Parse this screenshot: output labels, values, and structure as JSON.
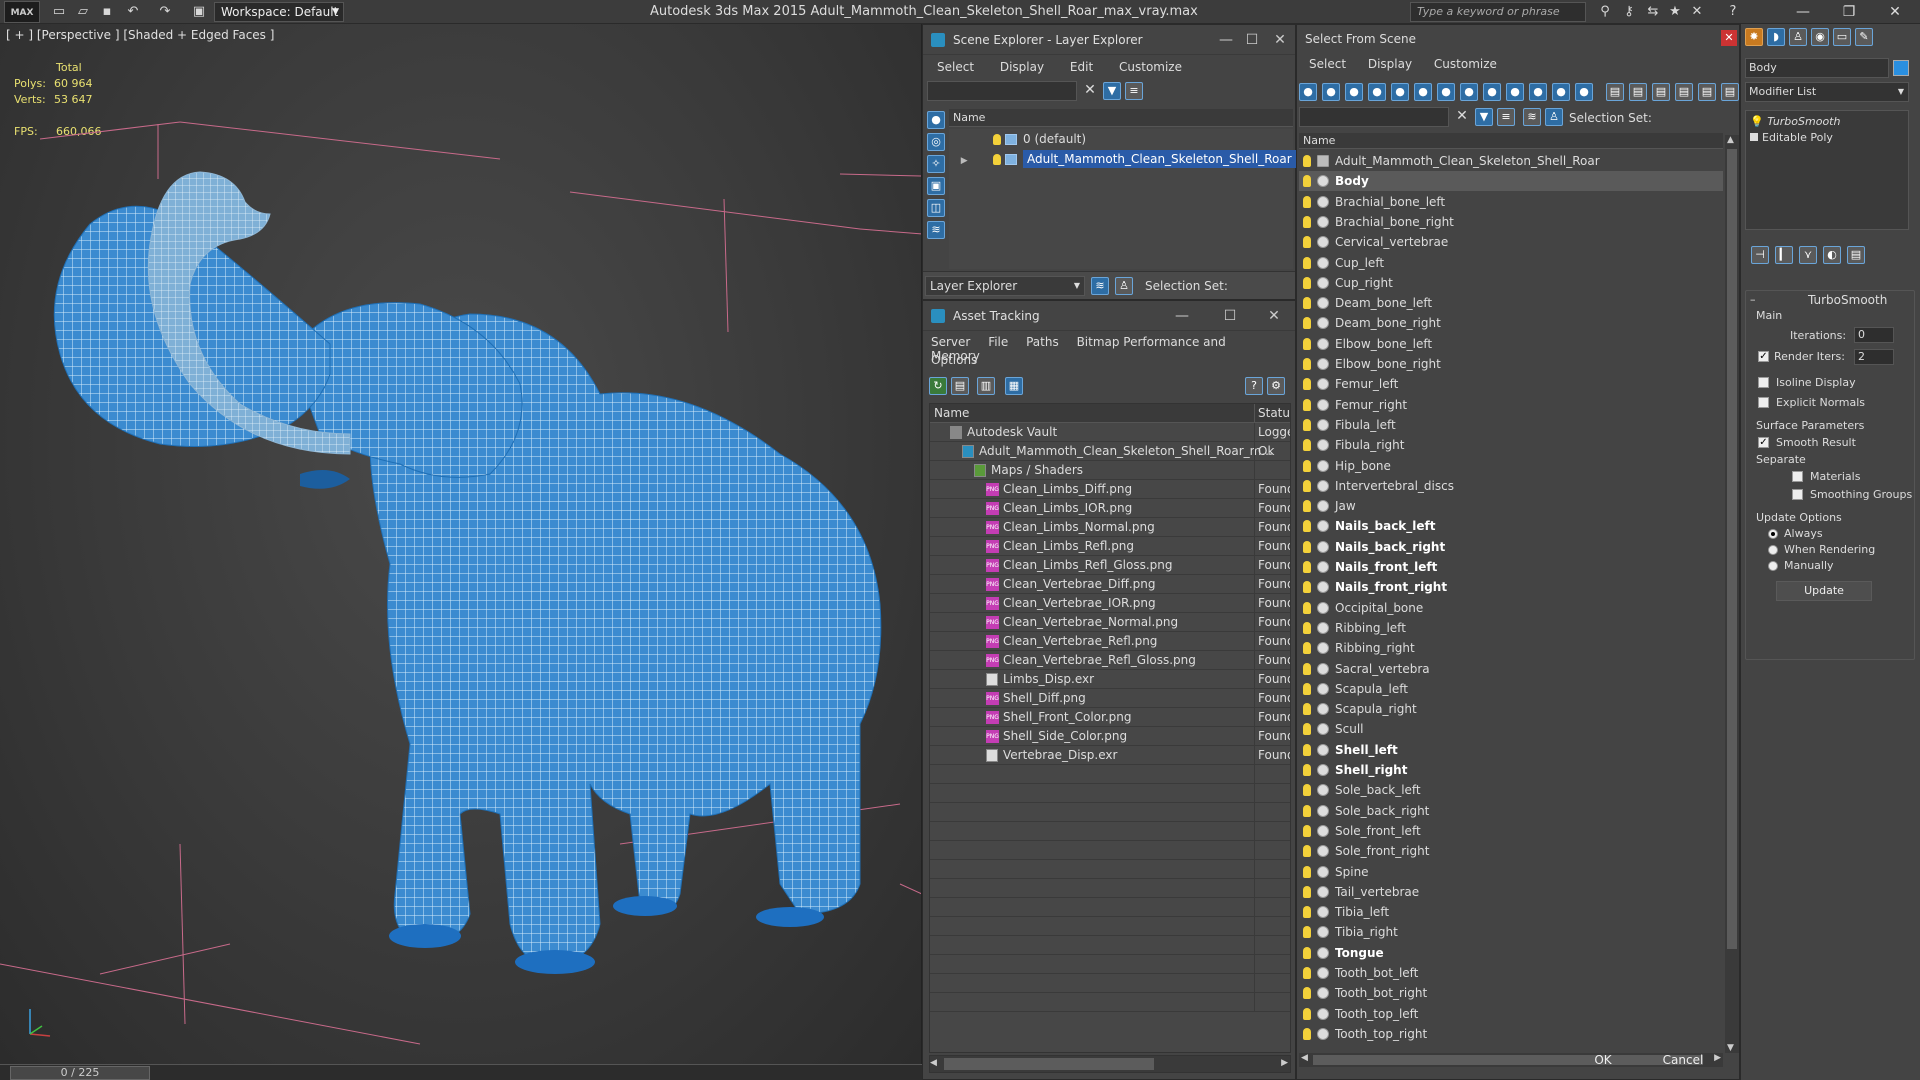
{
  "app": {
    "logo": "MAX",
    "title": "Autodesk 3ds Max  2015    Adult_Mammoth_Clean_Skeleton_Shell_Roar_max_vray.max",
    "workspace": "Workspace: Default",
    "search_placeholder": "Type a keyword or phrase"
  },
  "viewport": {
    "label": "[ + ] [Perspective ] [Shaded + Edged Faces ]",
    "stats": {
      "total_label": "Total",
      "polys_label": "Polys:",
      "polys": "60 964",
      "verts_label": "Verts:",
      "verts": "53 647",
      "fps_label": "FPS:",
      "fps": "660,066"
    },
    "timeline": "0 / 225"
  },
  "scene_explorer": {
    "title": "Scene Explorer - Layer Explorer",
    "menu": [
      "Select",
      "Display",
      "Edit",
      "Customize"
    ],
    "column": "Name",
    "rows": [
      {
        "label": "0 (default)",
        "selected": false
      },
      {
        "label": "Adult_Mammoth_Clean_Skeleton_Shell_Roar",
        "selected": true
      }
    ],
    "footer_dropdown": "Layer Explorer",
    "footer_selection_set": "Selection Set:"
  },
  "asset_tracking": {
    "title": "Asset Tracking",
    "menu": [
      "Server",
      "File",
      "Paths",
      "Bitmap Performance and Memory"
    ],
    "menu2": "Options",
    "col_name": "Name",
    "col_status": "Status",
    "rows": [
      {
        "name": "Autodesk Vault",
        "status": "Logged",
        "indent": 1,
        "kind": "vault"
      },
      {
        "name": "Adult_Mammoth_Clean_Skeleton_Shell_Roar_m...",
        "status": "Ok",
        "indent": 2,
        "kind": "max"
      },
      {
        "name": "Maps / Shaders",
        "status": "",
        "indent": 3,
        "kind": "folder"
      },
      {
        "name": "Clean_Limbs_Diff.png",
        "status": "Found",
        "indent": 4,
        "kind": "png"
      },
      {
        "name": "Clean_Limbs_IOR.png",
        "status": "Found",
        "indent": 4,
        "kind": "png"
      },
      {
        "name": "Clean_Limbs_Normal.png",
        "status": "Found",
        "indent": 4,
        "kind": "png"
      },
      {
        "name": "Clean_Limbs_Refl.png",
        "status": "Found",
        "indent": 4,
        "kind": "png"
      },
      {
        "name": "Clean_Limbs_Refl_Gloss.png",
        "status": "Found",
        "indent": 4,
        "kind": "png"
      },
      {
        "name": "Clean_Vertebrae_Diff.png",
        "status": "Found",
        "indent": 4,
        "kind": "png"
      },
      {
        "name": "Clean_Vertebrae_IOR.png",
        "status": "Found",
        "indent": 4,
        "kind": "png"
      },
      {
        "name": "Clean_Vertebrae_Normal.png",
        "status": "Found",
        "indent": 4,
        "kind": "png"
      },
      {
        "name": "Clean_Vertebrae_Refl.png",
        "status": "Found",
        "indent": 4,
        "kind": "png"
      },
      {
        "name": "Clean_Vertebrae_Refl_Gloss.png",
        "status": "Found",
        "indent": 4,
        "kind": "png"
      },
      {
        "name": "Limbs_Disp.exr",
        "status": "Found",
        "indent": 4,
        "kind": "exr"
      },
      {
        "name": "Shell_Diff.png",
        "status": "Found",
        "indent": 4,
        "kind": "png"
      },
      {
        "name": "Shell_Front_Color.png",
        "status": "Found",
        "indent": 4,
        "kind": "png"
      },
      {
        "name": "Shell_Side_Color.png",
        "status": "Found",
        "indent": 4,
        "kind": "png"
      },
      {
        "name": "Vertebrae_Disp.exr",
        "status": "Found",
        "indent": 4,
        "kind": "exr"
      }
    ]
  },
  "select_from_scene": {
    "title": "Select From Scene",
    "menu": [
      "Select",
      "Display",
      "Customize"
    ],
    "selection_set": "Selection Set:",
    "column": "Name",
    "items": [
      {
        "name": "Adult_Mammoth_Clean_Skeleton_Shell_Roar",
        "bold": false,
        "hl": false
      },
      {
        "name": "Body",
        "bold": true,
        "hl": true
      },
      {
        "name": "Brachial_bone_left",
        "bold": false,
        "hl": false
      },
      {
        "name": "Brachial_bone_right",
        "bold": false,
        "hl": false
      },
      {
        "name": "Cervical_vertebrae",
        "bold": false,
        "hl": false
      },
      {
        "name": "Cup_left",
        "bold": false,
        "hl": false
      },
      {
        "name": "Cup_right",
        "bold": false,
        "hl": false
      },
      {
        "name": "Deam_bone_left",
        "bold": false,
        "hl": false
      },
      {
        "name": "Deam_bone_right",
        "bold": false,
        "hl": false
      },
      {
        "name": "Elbow_bone_left",
        "bold": false,
        "hl": false
      },
      {
        "name": "Elbow_bone_right",
        "bold": false,
        "hl": false
      },
      {
        "name": "Femur_left",
        "bold": false,
        "hl": false
      },
      {
        "name": "Femur_right",
        "bold": false,
        "hl": false
      },
      {
        "name": "Fibula_left",
        "bold": false,
        "hl": false
      },
      {
        "name": "Fibula_right",
        "bold": false,
        "hl": false
      },
      {
        "name": "Hip_bone",
        "bold": false,
        "hl": false
      },
      {
        "name": "Intervertebral_discs",
        "bold": false,
        "hl": false
      },
      {
        "name": "Jaw",
        "bold": false,
        "hl": false
      },
      {
        "name": "Nails_back_left",
        "bold": true,
        "hl": false
      },
      {
        "name": "Nails_back_right",
        "bold": true,
        "hl": false
      },
      {
        "name": "Nails_front_left",
        "bold": true,
        "hl": false
      },
      {
        "name": "Nails_front_right",
        "bold": true,
        "hl": false
      },
      {
        "name": "Occipital_bone",
        "bold": false,
        "hl": false
      },
      {
        "name": "Ribbing_left",
        "bold": false,
        "hl": false
      },
      {
        "name": "Ribbing_right",
        "bold": false,
        "hl": false
      },
      {
        "name": "Sacral_vertebra",
        "bold": false,
        "hl": false
      },
      {
        "name": "Scapula_left",
        "bold": false,
        "hl": false
      },
      {
        "name": "Scapula_right",
        "bold": false,
        "hl": false
      },
      {
        "name": "Scull",
        "bold": false,
        "hl": false
      },
      {
        "name": "Shell_left",
        "bold": true,
        "hl": false
      },
      {
        "name": "Shell_right",
        "bold": true,
        "hl": false
      },
      {
        "name": "Sole_back_left",
        "bold": false,
        "hl": false
      },
      {
        "name": "Sole_back_right",
        "bold": false,
        "hl": false
      },
      {
        "name": "Sole_front_left",
        "bold": false,
        "hl": false
      },
      {
        "name": "Sole_front_right",
        "bold": false,
        "hl": false
      },
      {
        "name": "Spine",
        "bold": false,
        "hl": false
      },
      {
        "name": "Tail_vertebrae",
        "bold": false,
        "hl": false
      },
      {
        "name": "Tibia_left",
        "bold": false,
        "hl": false
      },
      {
        "name": "Tibia_right",
        "bold": false,
        "hl": false
      },
      {
        "name": "Tongue",
        "bold": true,
        "hl": false
      },
      {
        "name": "Tooth_bot_left",
        "bold": false,
        "hl": false
      },
      {
        "name": "Tooth_bot_right",
        "bold": false,
        "hl": false
      },
      {
        "name": "Tooth_top_left",
        "bold": false,
        "hl": false
      },
      {
        "name": "Tooth_top_right",
        "bold": false,
        "hl": false
      }
    ],
    "ok": "OK",
    "cancel": "Cancel"
  },
  "command_panel": {
    "object_name": "Body",
    "modifier_list": "Modifier List",
    "stack": [
      "TurboSmooth",
      "Editable Poly"
    ],
    "rollout_title": "TurboSmooth",
    "main_label": "Main",
    "iterations_label": "Iterations:",
    "iterations": "0",
    "render_iters_label": "Render Iters:",
    "render_iters": "2",
    "isoline": "Isoline Display",
    "explicit_normals": "Explicit Normals",
    "surface_params": "Surface Parameters",
    "smooth_result": "Smooth Result",
    "separate": "Separate",
    "materials": "Materials",
    "smoothing_groups": "Smoothing Groups",
    "update_options": "Update Options",
    "always": "Always",
    "when_rendering": "When Rendering",
    "manually": "Manually",
    "update_btn": "Update"
  },
  "colors": {
    "wire": "#cfe7f7",
    "body": "#3a8fd4",
    "selection": "#2a5ba8"
  }
}
